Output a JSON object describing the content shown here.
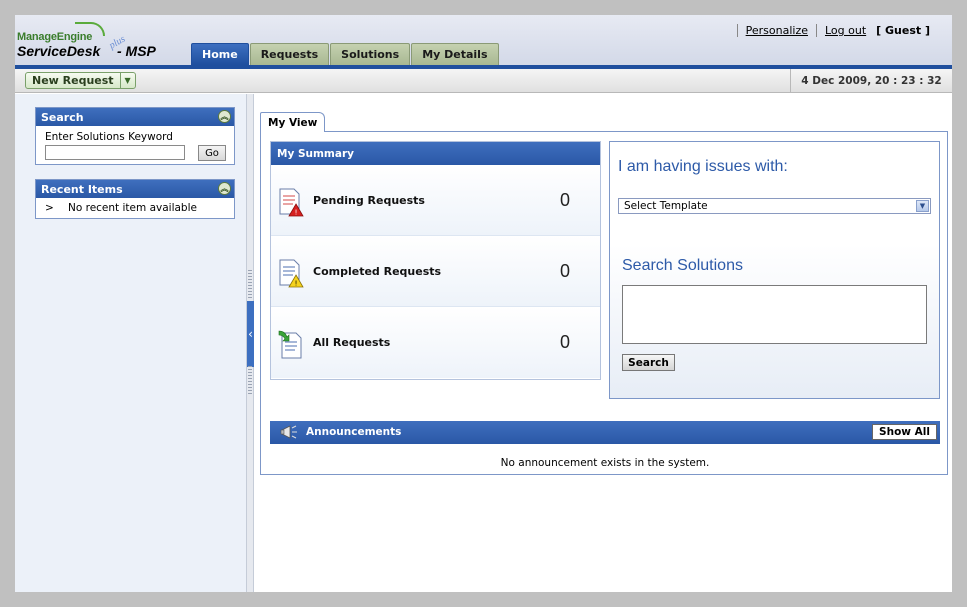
{
  "header": {
    "logo": {
      "brand": "ManageEngine",
      "product": "ServiceDesk",
      "plus": "plus",
      "edition": "- MSP"
    },
    "tabs": [
      {
        "label": "Home",
        "active": true
      },
      {
        "label": "Requests",
        "active": false
      },
      {
        "label": "Solutions",
        "active": false
      },
      {
        "label": "My Details",
        "active": false
      }
    ],
    "links": {
      "personalize": "Personalize",
      "logout": "Log out",
      "guest": "[ Guest ]"
    }
  },
  "toolbar": {
    "new_request": "New Request",
    "datetime": "4 Dec 2009, 20 : 23 : 32"
  },
  "sidebar": {
    "search": {
      "title": "Search",
      "keyword_label": "Enter Solutions Keyword",
      "input_value": "",
      "go_label": "Go"
    },
    "recent": {
      "title": "Recent Items",
      "bullet": ">",
      "empty_text": "No recent item available"
    }
  },
  "main": {
    "view_tab": "My View",
    "summary": {
      "title": "My Summary",
      "rows": [
        {
          "label": "Pending Requests",
          "count": "0",
          "icon": "pending-requests-icon"
        },
        {
          "label": "Completed Requests",
          "count": "0",
          "icon": "completed-requests-icon"
        },
        {
          "label": "All Requests",
          "count": "0",
          "icon": "all-requests-icon"
        }
      ]
    },
    "issues": {
      "title": "I am having issues with:",
      "template_selected": "Select Template",
      "search_title": "Search Solutions",
      "search_value": "",
      "search_button": "Search"
    },
    "announcements": {
      "title": "Announcements",
      "show_all": "Show All",
      "empty_text": "No announcement exists in the system."
    }
  },
  "colors": {
    "header_blue": "#2a58a6",
    "title_blue": "#2d5aa8",
    "tab_green": "#a8b892"
  }
}
